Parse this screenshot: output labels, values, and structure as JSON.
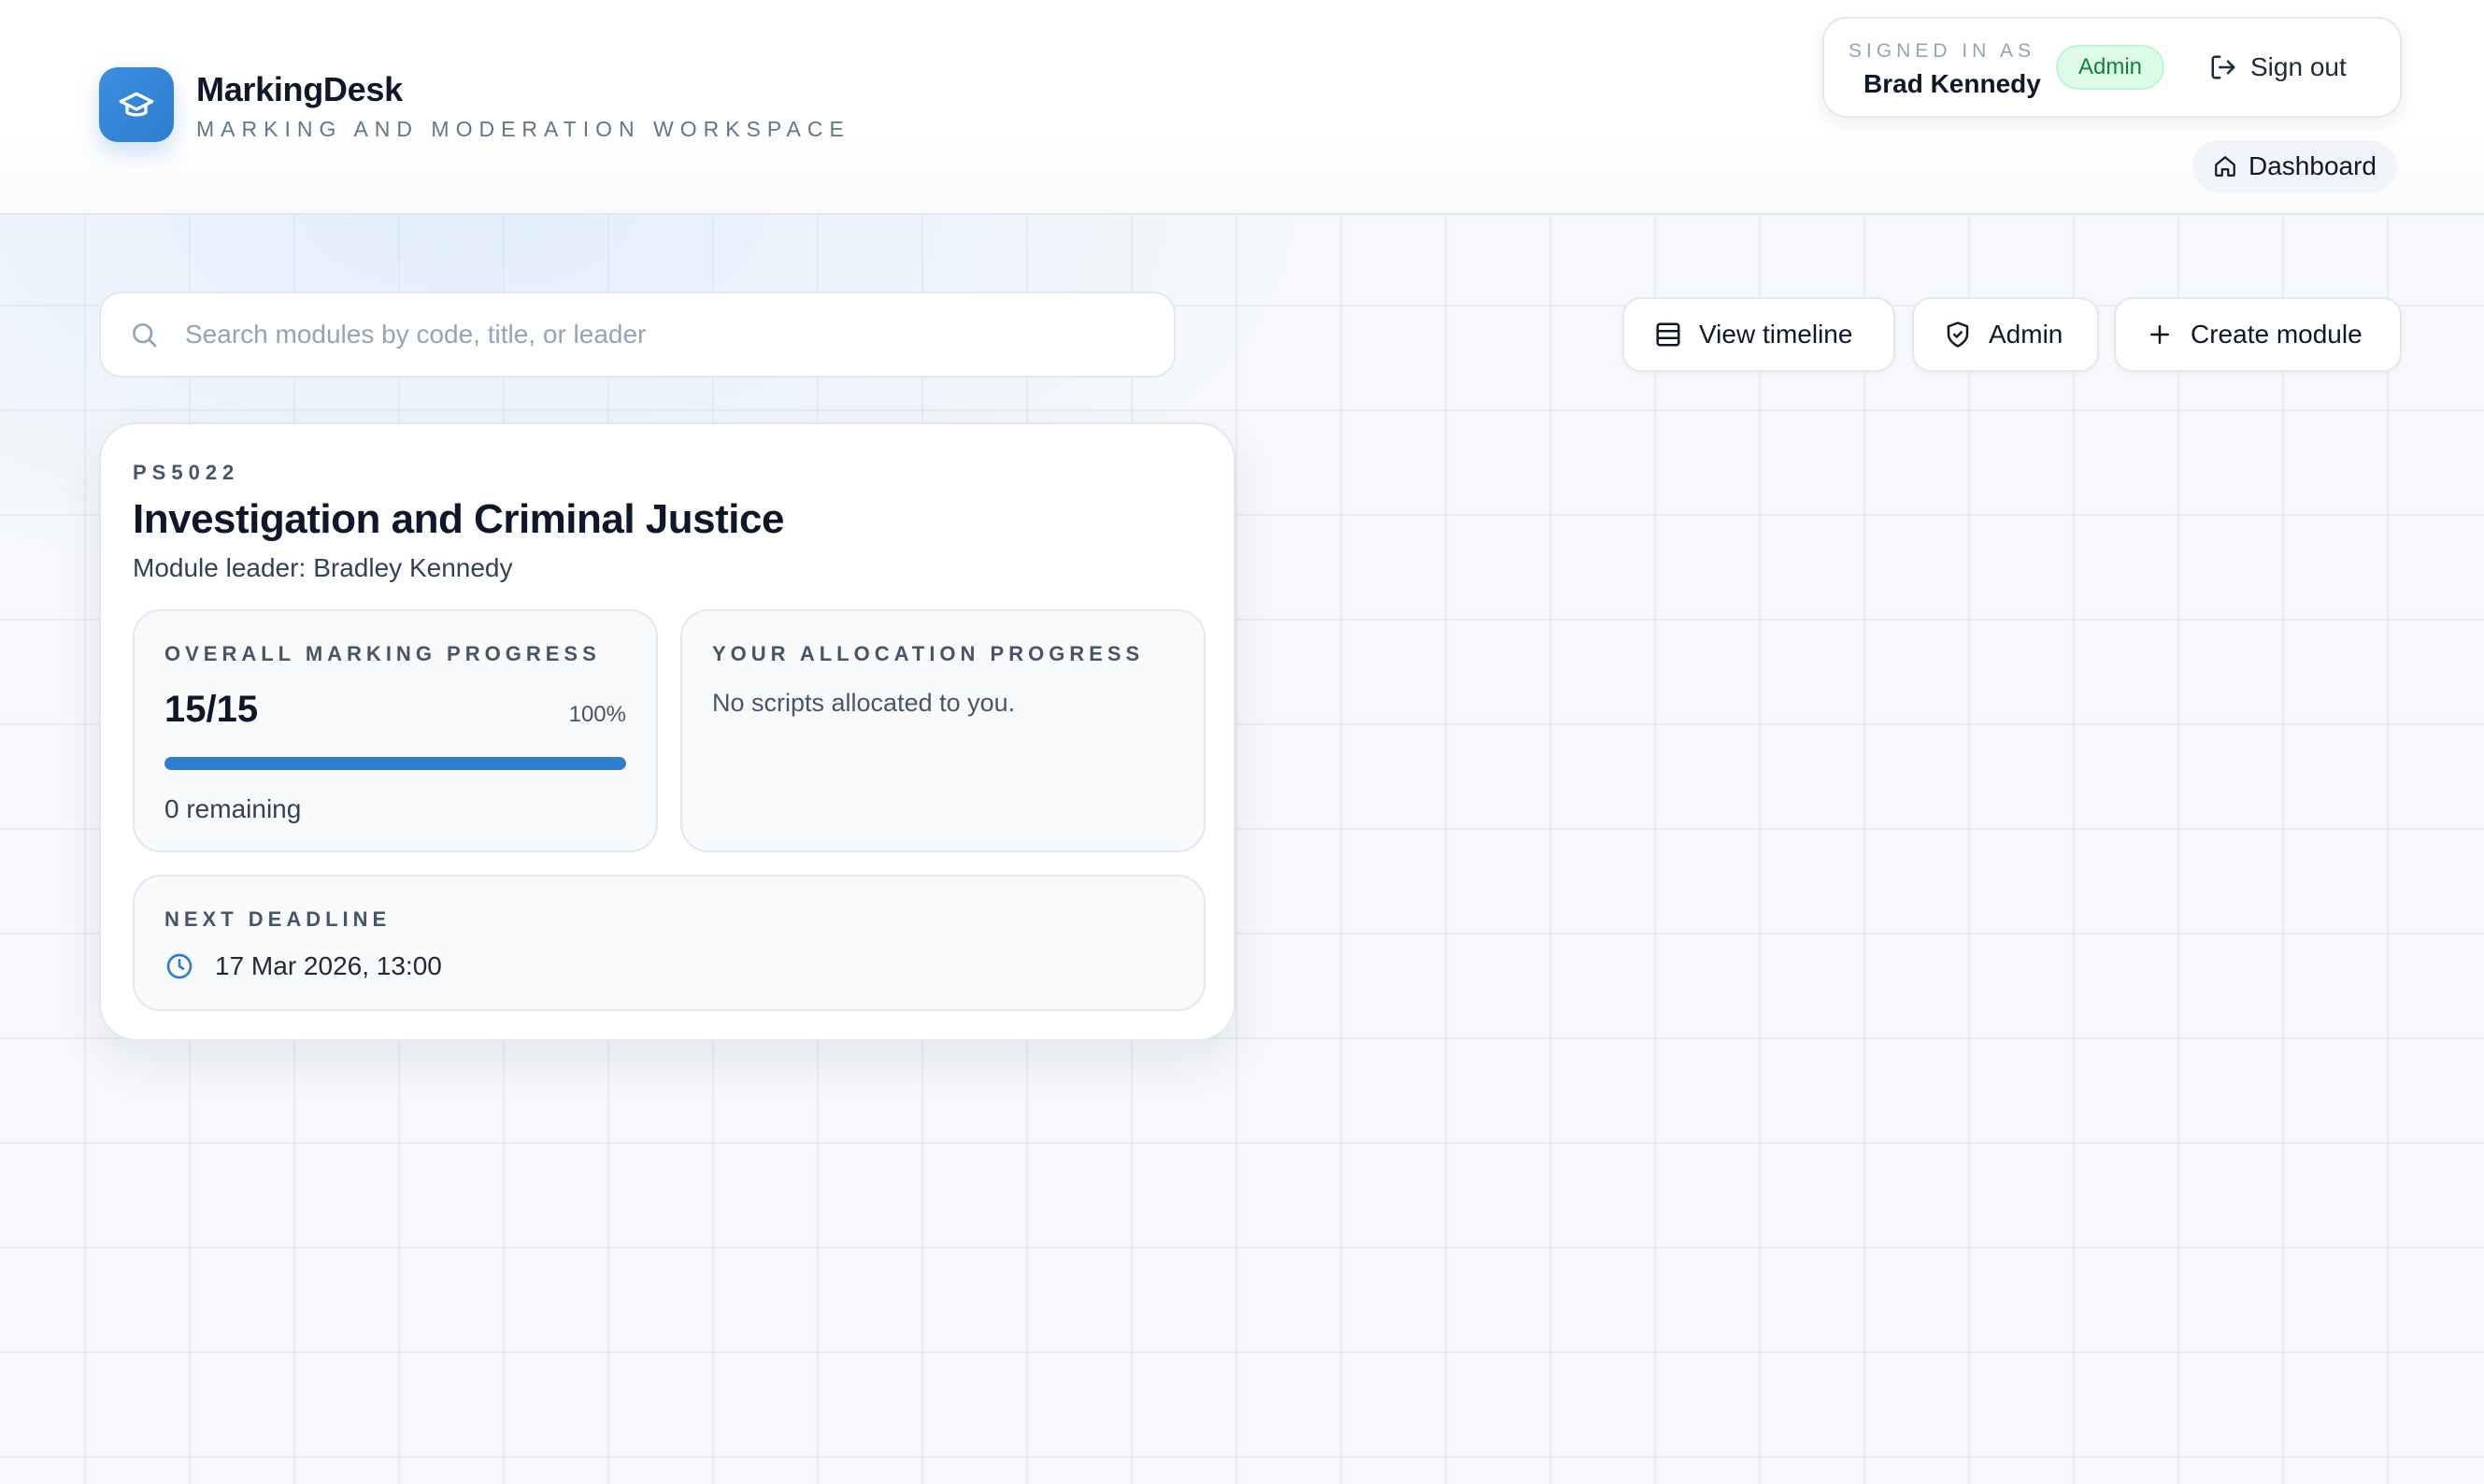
{
  "app": {
    "name": "MarkingDesk",
    "subtitle": "MARKING AND MODERATION WORKSPACE",
    "logo_icon": "graduation-cap-icon",
    "accent_color": "#2f7dcf"
  },
  "user": {
    "signed_in_label": "SIGNED IN AS",
    "name": "Brad Kennedy",
    "role": "Admin",
    "sign_out_label": "Sign out"
  },
  "nav": {
    "dashboard_label": "Dashboard"
  },
  "toolbar": {
    "search_placeholder": "Search modules by code, title, or leader",
    "search_value": "",
    "view_timeline_label": "View timeline",
    "admin_label": "Admin",
    "create_module_label": "Create module"
  },
  "modules": [
    {
      "code": "PS5022",
      "title": "Investigation and Criminal Justice",
      "leader_prefix": "Module leader:",
      "leader_name": "Bradley Kennedy",
      "overall_label": "OVERALL MARKING PROGRESS",
      "overall_count": "15/15",
      "overall_percent": "100%",
      "overall_fraction": 1.0,
      "overall_remaining": "0 remaining",
      "allocation_label": "YOUR ALLOCATION PROGRESS",
      "allocation_text": "No scripts allocated to you.",
      "deadline_label": "NEXT DEADLINE",
      "deadline_value": "17 Mar 2026, 13:00"
    }
  ]
}
